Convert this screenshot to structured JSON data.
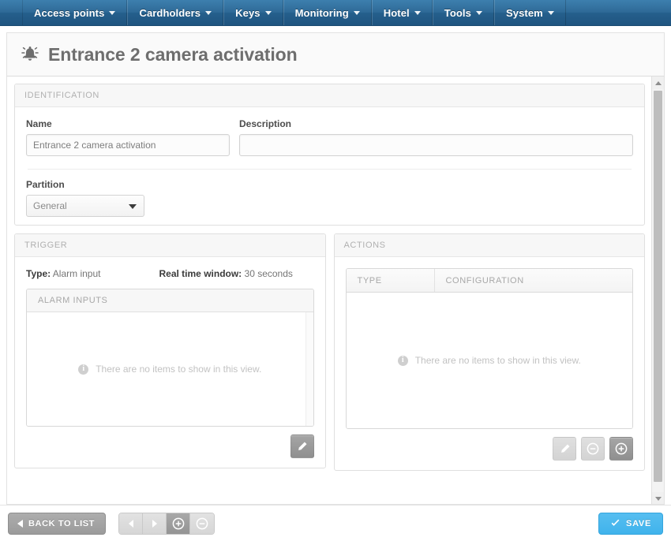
{
  "navbar": {
    "items": [
      {
        "label": "Access points",
        "icon": "chevron-down-icon"
      },
      {
        "label": "Cardholders",
        "icon": "chevron-down-icon"
      },
      {
        "label": "Keys",
        "icon": "chevron-down-icon"
      },
      {
        "label": "Monitoring",
        "icon": "chevron-down-icon"
      },
      {
        "label": "Hotel",
        "icon": "chevron-down-icon"
      },
      {
        "label": "Tools",
        "icon": "chevron-down-icon"
      },
      {
        "label": "System",
        "icon": "chevron-down-icon"
      }
    ]
  },
  "page": {
    "title": "Entrance 2 camera activation",
    "icon": "alarm-bell-icon"
  },
  "identification": {
    "header": "IDENTIFICATION",
    "name_label": "Name",
    "name_value": "Entrance 2 camera activation",
    "description_label": "Description",
    "description_value": "",
    "description_placeholder": "",
    "partition_label": "Partition",
    "partition_value": "General",
    "partition_options": [
      "General"
    ]
  },
  "trigger": {
    "header": "TRIGGER",
    "type_label": "Type:",
    "type_value": "Alarm input",
    "window_label": "Real time window:",
    "window_value": "30 seconds",
    "list_header": "ALARM INPUTS",
    "empty_message": "There are no items to show in this view.",
    "empty_icon": "info-icon",
    "edit_button_icon": "pencil-icon"
  },
  "actions": {
    "header": "ACTIONS",
    "columns": [
      "TYPE",
      "CONFIGURATION"
    ],
    "rows": [],
    "empty_message": "There are no items to show in this view.",
    "empty_icon": "info-icon",
    "buttons": [
      {
        "icon": "pencil-icon",
        "state": "disabled"
      },
      {
        "icon": "minus-circle-icon",
        "state": "disabled"
      },
      {
        "icon": "plus-circle-icon",
        "state": "active"
      }
    ]
  },
  "footer": {
    "back_label": "BACK TO LIST",
    "back_icon": "chevron-left-icon",
    "nav_buttons": [
      {
        "icon": "chevron-left-icon",
        "state": "disabled"
      },
      {
        "icon": "chevron-right-icon",
        "state": "disabled"
      },
      {
        "icon": "plus-circle-icon",
        "state": "active"
      },
      {
        "icon": "minus-circle-icon",
        "state": "disabled"
      }
    ],
    "save_label": "SAVE",
    "save_icon": "check-icon"
  },
  "colors": {
    "navbar_blue": "#2e6a97",
    "save_blue": "#40b3ec",
    "panel_border": "#dfdfdf",
    "muted_text": "#b0b0b0"
  }
}
